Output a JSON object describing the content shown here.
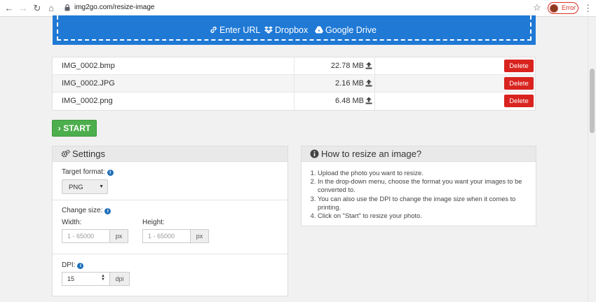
{
  "browser": {
    "url": "img2go.com/resize-image",
    "profile_status": "Error"
  },
  "upload": {
    "options": [
      {
        "label": "Enter URL",
        "icon": "link-icon"
      },
      {
        "label": "Dropbox",
        "icon": "dropbox-icon"
      },
      {
        "label": "Google Drive",
        "icon": "google-drive-icon"
      }
    ]
  },
  "files": [
    {
      "name": "IMG_0002.bmp",
      "size": "22.78 MB",
      "action": "Delete"
    },
    {
      "name": "IMG_0002.JPG",
      "size": "2.16 MB",
      "action": "Delete"
    },
    {
      "name": "IMG_0002.png",
      "size": "6.48 MB",
      "action": "Delete"
    }
  ],
  "start_label": "START",
  "settings": {
    "title": "Settings",
    "target_format_label": "Target format:",
    "target_format_value": "PNG",
    "change_size_label": "Change size:",
    "width_label": "Width:",
    "height_label": "Height:",
    "width_placeholder": "1 - 65000",
    "height_placeholder": "1 - 65000",
    "unit_px": "px",
    "dpi_label": "DPI:",
    "dpi_value": "15",
    "dpi_unit": "dpi"
  },
  "howto": {
    "title": "How to resize an image?",
    "steps": [
      "Upload the photo you want to resize.",
      "In the drop-down menu, choose the format you want your images to be converted to.",
      "You can also use the DPI to change the image size when it comes to printing.",
      "Click on \"Start\" to resize your photo."
    ]
  },
  "colors": {
    "upload_blue": "#1f79d5",
    "delete_red": "#d9231f",
    "start_green": "#4cae4c",
    "info_blue": "#1f6fb8"
  }
}
